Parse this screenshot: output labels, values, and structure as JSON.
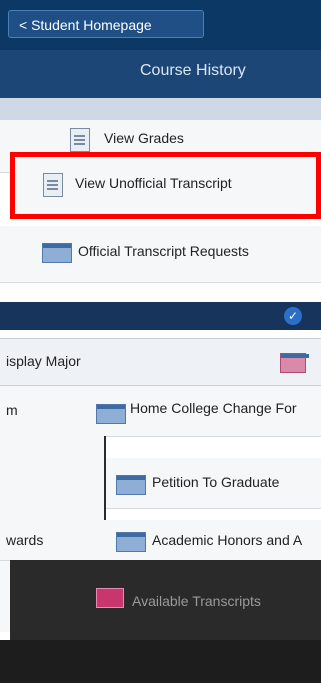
{
  "header": {
    "home_button": "< Student Homepage",
    "section_title": "Course History"
  },
  "menu": {
    "view_grades": "View Grades",
    "view_unofficial_transcript": "View Unofficial Transcript",
    "official_transcript_requests": "Official Transcript Requests"
  },
  "rows": {
    "display_major": "isplay Major",
    "row_b_left": "m",
    "home_college_change": "Home College Change For",
    "petition_to_graduate": "Petition To Graduate",
    "awards": "wards",
    "academic_honors": "Academic Honors and A",
    "available_transcripts": "Available Transcripts"
  }
}
